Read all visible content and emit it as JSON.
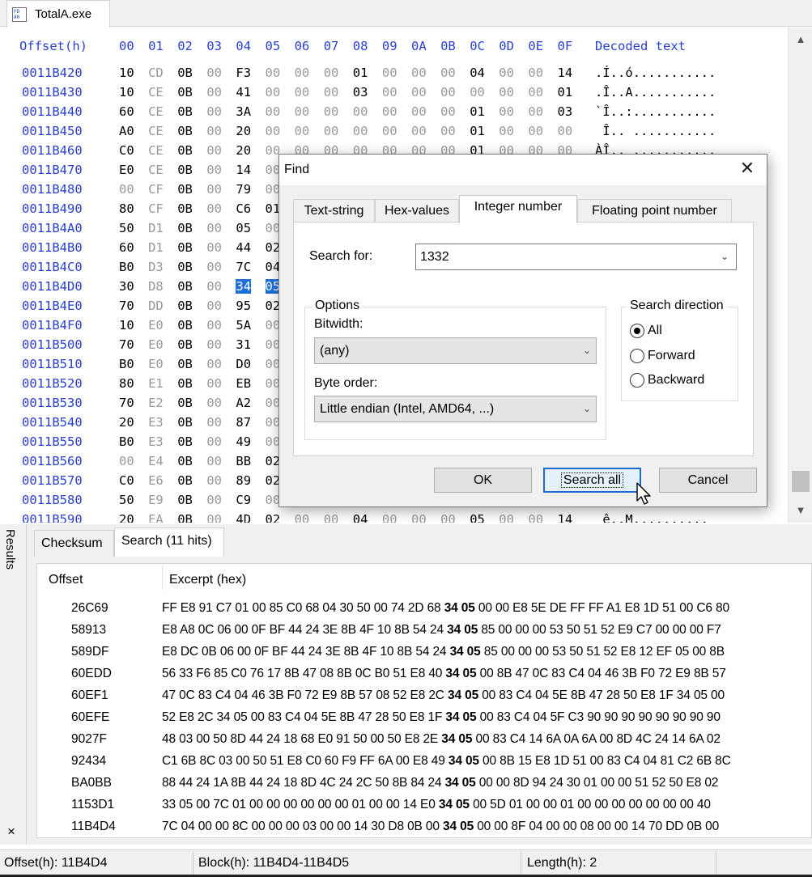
{
  "file_tab": {
    "name": "TotalA.exe",
    "icon": "exe-file-icon",
    "icon_text": [
      "FD",
      "A0"
    ]
  },
  "hex": {
    "header": {
      "offset_label": "Offset(h)",
      "columns": [
        "00",
        "01",
        "02",
        "03",
        "04",
        "05",
        "06",
        "07",
        "08",
        "09",
        "0A",
        "0B",
        "0C",
        "0D",
        "0E",
        "0F"
      ],
      "decoded_label": "Decoded text"
    },
    "rows": [
      {
        "offset": "0011B420",
        "bytes": [
          "10",
          "CD",
          "0B",
          "00",
          "F3",
          "00",
          "00",
          "00",
          "01",
          "00",
          "00",
          "00",
          "04",
          "00",
          "00",
          "14"
        ],
        "decoded": ".Í..ó..........."
      },
      {
        "offset": "0011B430",
        "bytes": [
          "10",
          "CE",
          "0B",
          "00",
          "41",
          "00",
          "00",
          "00",
          "03",
          "00",
          "00",
          "00",
          "00",
          "00",
          "00",
          "01"
        ],
        "decoded": ".Î..A..........."
      },
      {
        "offset": "0011B440",
        "bytes": [
          "60",
          "CE",
          "0B",
          "00",
          "3A",
          "00",
          "00",
          "00",
          "00",
          "00",
          "00",
          "00",
          "01",
          "00",
          "00",
          "03"
        ],
        "decoded": "`Î..:..........."
      },
      {
        "offset": "0011B450",
        "bytes": [
          "A0",
          "CE",
          "0B",
          "00",
          "20",
          "00",
          "00",
          "00",
          "00",
          "00",
          "00",
          "00",
          "01",
          "00",
          "00",
          "00"
        ],
        "decoded": " Î.. ..........."
      },
      {
        "offset": "0011B460",
        "bytes": [
          "C0",
          "CE",
          "0B",
          "00",
          "20",
          "00",
          "00",
          "00",
          "00",
          "00",
          "00",
          "00",
          "01",
          "00",
          "00",
          "00"
        ],
        "decoded": "ÀÎ.. ..........."
      },
      {
        "offset": "0011B470",
        "bytes": [
          "E0",
          "CE",
          "0B",
          "00",
          "14",
          "00"
        ],
        "decoded": ""
      },
      {
        "offset": "0011B480",
        "bytes": [
          "00",
          "CF",
          "0B",
          "00",
          "79",
          "00"
        ],
        "decoded": ""
      },
      {
        "offset": "0011B490",
        "bytes": [
          "80",
          "CF",
          "0B",
          "00",
          "C6",
          "01"
        ],
        "decoded": ""
      },
      {
        "offset": "0011B4A0",
        "bytes": [
          "50",
          "D1",
          "0B",
          "00",
          "05",
          "00"
        ],
        "decoded": ""
      },
      {
        "offset": "0011B4B0",
        "bytes": [
          "60",
          "D1",
          "0B",
          "00",
          "44",
          "02"
        ],
        "decoded": ""
      },
      {
        "offset": "0011B4C0",
        "bytes": [
          "B0",
          "D3",
          "0B",
          "00",
          "7C",
          "04"
        ],
        "decoded": ""
      },
      {
        "offset": "0011B4D0",
        "bytes": [
          "30",
          "D8",
          "0B",
          "00",
          "34",
          "05"
        ],
        "decoded": ""
      },
      {
        "offset": "0011B4E0",
        "bytes": [
          "70",
          "DD",
          "0B",
          "00",
          "95",
          "02"
        ],
        "decoded": ""
      },
      {
        "offset": "0011B4F0",
        "bytes": [
          "10",
          "E0",
          "0B",
          "00",
          "5A",
          "00"
        ],
        "decoded": ""
      },
      {
        "offset": "0011B500",
        "bytes": [
          "70",
          "E0",
          "0B",
          "00",
          "31",
          "00"
        ],
        "decoded": ""
      },
      {
        "offset": "0011B510",
        "bytes": [
          "B0",
          "E0",
          "0B",
          "00",
          "D0",
          "00"
        ],
        "decoded": ""
      },
      {
        "offset": "0011B520",
        "bytes": [
          "80",
          "E1",
          "0B",
          "00",
          "EB",
          "00"
        ],
        "decoded": ""
      },
      {
        "offset": "0011B530",
        "bytes": [
          "70",
          "E2",
          "0B",
          "00",
          "A2",
          "00"
        ],
        "decoded": ""
      },
      {
        "offset": "0011B540",
        "bytes": [
          "20",
          "E3",
          "0B",
          "00",
          "87",
          "00"
        ],
        "decoded": ""
      },
      {
        "offset": "0011B550",
        "bytes": [
          "B0",
          "E3",
          "0B",
          "00",
          "49",
          "00"
        ],
        "decoded": ""
      },
      {
        "offset": "0011B560",
        "bytes": [
          "00",
          "E4",
          "0B",
          "00",
          "BB",
          "02"
        ],
        "decoded": ""
      },
      {
        "offset": "0011B570",
        "bytes": [
          "C0",
          "E6",
          "0B",
          "00",
          "89",
          "02"
        ],
        "decoded": ""
      },
      {
        "offset": "0011B580",
        "bytes": [
          "50",
          "E9",
          "0B",
          "00",
          "C9",
          "00"
        ],
        "decoded": ""
      },
      {
        "offset": "0011B590",
        "bytes": [
          "20",
          "EA",
          "0B",
          "00",
          "4D",
          "02",
          "00",
          "00",
          "04",
          "00",
          "00",
          "00",
          "05",
          "00",
          "00",
          "14"
        ],
        "decoded": " ê..M.........."
      }
    ],
    "selected": {
      "row": 11,
      "bytes": [
        4,
        5
      ]
    }
  },
  "find_dialog": {
    "title": "Find",
    "tabs": [
      "Text-string",
      "Hex-values",
      "Integer number",
      "Floating point number"
    ],
    "active_tab": "Integer number",
    "search_label": "Search for:",
    "search_value": "1332",
    "options_legend": "Options",
    "bitwidth_label": "Bitwidth:",
    "bitwidth_value": "(any)",
    "byteorder_label": "Byte order:",
    "byteorder_value": "Little endian (Intel, AMD64, ...)",
    "direction_legend": "Search direction",
    "directions": [
      "All",
      "Forward",
      "Backward"
    ],
    "direction_selected": "All",
    "ok_label": "OK",
    "search_all_label": "Search all",
    "cancel_label": "Cancel"
  },
  "results": {
    "side_label": "Results",
    "close_glyph": "×",
    "tabs": [
      "Checksum",
      "Search (11 hits)"
    ],
    "active_tab": "Search (11 hits)",
    "columns": [
      "Offset",
      "Excerpt (hex)"
    ],
    "rows": [
      {
        "offset": "26C69",
        "pre": "FF E8 91 C7 01 00 85 C0 68 04 30 50 00 74 2D 68 ",
        "hit": "34 05",
        "post": " 00 00 E8 5E DE FF FF A1 E8 1D 51 00 C6 80"
      },
      {
        "offset": "58913",
        "pre": "E8 A8 0C 06 00 0F BF 44 24 3E 8B 4F 10 8B 54 24 ",
        "hit": "34 05",
        "post": " 85 00 00 00 53 50 51 52 E9 C7 00 00 00 F7"
      },
      {
        "offset": "589DF",
        "pre": "E8 DC 0B 06 00 0F BF 44 24 3E 8B 4F 10 8B 54 24 ",
        "hit": "34 05",
        "post": " 85 00 00 00 53 50 51 52 E8 12 EF 05 00 8B"
      },
      {
        "offset": "60EDD",
        "pre": "56 33 F6 85 C0 76 17 8B 47 08 8B 0C B0 51 E8 40 ",
        "hit": "34 05",
        "post": " 00 8B 47 0C 83 C4 04 46 3B F0 72 E9 8B 57"
      },
      {
        "offset": "60EF1",
        "pre": "47 0C 83 C4 04 46 3B F0 72 E9 8B 57 08 52 E8 2C ",
        "hit": "34 05",
        "post": " 00 83 C4 04 5E 8B 47 28 50 E8 1F 34 05 00"
      },
      {
        "offset": "60EFE",
        "pre": "52 E8 2C 34 05 00 83 C4 04 5E 8B 47 28 50 E8 1F ",
        "hit": "34 05",
        "post": " 00 83 C4 04 5F C3 90 90 90 90 90 90 90 90"
      },
      {
        "offset": "9027F",
        "pre": "48 03 00 50 8D 44 24 18 68 E0 91 50 00 50 E8 2E ",
        "hit": "34 05",
        "post": " 00 83 C4 14 6A 0A 6A 00 8D 4C 24 14 6A 02"
      },
      {
        "offset": "92434",
        "pre": "C1 6B 8C 03 00 50 51 E8 C0 60 F9 FF 6A 00 E8 49 ",
        "hit": "34 05",
        "post": " 00 8B 15 E8 1D 51 00 83 C4 04 81 C2 6B 8C"
      },
      {
        "offset": "BA0BB",
        "pre": "88 44 24 1A 8B 44 24 18 8D 4C 24 2C 50 8B 84 24 ",
        "hit": "34 05",
        "post": " 00 00 8D 94 24 30 01 00 00 51 52 50 E8 02"
      },
      {
        "offset": "1153D1",
        "pre": "33 05 00 7C 01 00 00 00 00 00 00 01 00 00 14 E0 ",
        "hit": "34 05",
        "post": " 00 5D 01 00 00 01 00 00 00 00 00 00 00 40"
      },
      {
        "offset": "11B4D4",
        "pre": "7C 04 00 00 8C 00 00 00 03 00 00 14 30 D8 0B 00 ",
        "hit": "34 05",
        "post": " 00 00 8F 04 00 00 08 00 00 14 70 DD 0B 00"
      }
    ]
  },
  "status": {
    "offset": "Offset(h): 11B4D4",
    "block": "Block(h): 11B4D4-11B4D5",
    "length": "Length(h): 2"
  }
}
